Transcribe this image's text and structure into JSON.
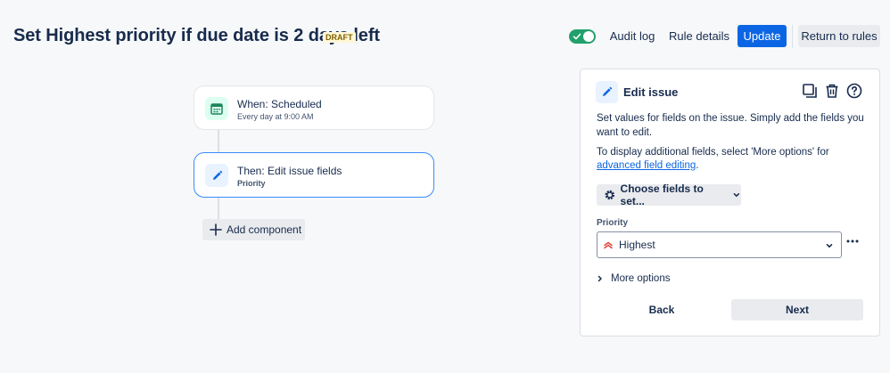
{
  "header": {
    "title": "Set Highest priority if due date is 2 days left",
    "badge": "DRAFT",
    "toggle_state": "on",
    "audit_log_label": "Audit log",
    "rule_details_label": "Rule details",
    "update_label": "Update",
    "return_label": "Return to rules"
  },
  "colors": {
    "primary": "#0c66e4",
    "toggle_on": "#22a06b",
    "trigger_bg": "#dcfff1",
    "action_bg": "#e9f2ff",
    "priority_highest": "#e2483d"
  },
  "flow": {
    "trigger": {
      "title": "When: Scheduled",
      "subtitle": "Every day at 9:00 AM",
      "icon": "calendar-icon"
    },
    "action": {
      "title": "Then: Edit issue fields",
      "subtitle": "Priority",
      "icon": "pencil-icon"
    },
    "add_component_label": "Add component"
  },
  "panel": {
    "title": "Edit issue",
    "icon": "pencil-icon",
    "description": "Set values for fields on the issue. Simply add the fields you want to edit.",
    "additional_text": "To display additional fields, select 'More options' for",
    "link_text": "advanced field editing",
    "link_suffix": ".",
    "choose_fields_label": "Choose fields to set...",
    "field": {
      "label": "Priority",
      "value": "Highest",
      "icon": "priority-highest-icon"
    },
    "more_options_label": "More options",
    "back_label": "Back",
    "next_label": "Next"
  }
}
